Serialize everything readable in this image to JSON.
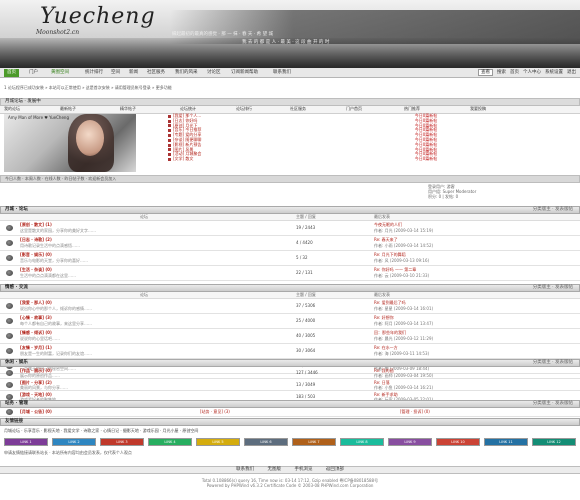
{
  "banner": {
    "logo": "Yuecheng",
    "logo_sub": "Moonshot2.cn",
    "slogan_line1": "縁起最初的最真的感觉 · 那 一 抹 · 春 天 · 希 望 城",
    "slogan_line2": "我 去 的 都 是 人 · 最 美 · 这 段 曲 开 的 时"
  },
  "nav": {
    "items": [
      {
        "label": "首页",
        "active": true
      },
      {
        "label": "门户",
        "active": false
      },
      {
        "label": "黄图空间",
        "active": false,
        "green": true
      },
      {
        "label": "统计排行",
        "active": false
      },
      {
        "label": "空间",
        "active": false
      },
      {
        "label": "新闻",
        "active": false
      },
      {
        "label": "社区服务",
        "active": false
      },
      {
        "label": "我们的风采",
        "active": false
      },
      {
        "label": "讨论区",
        "active": false
      },
      {
        "label": "订阅新闻帮助",
        "active": false
      },
      {
        "label": "联系我们",
        "active": false
      }
    ],
    "right": [
      "搜索",
      "首页",
      "个人中心",
      "系统设置",
      "退出"
    ],
    "select_value": "查看"
  },
  "search_strip": {
    "path": "1 论坛程序已成功安装 » 本站可以正常使用 » 这是首次安装 » 请用管理员帐号登录 » 更多功能"
  },
  "board_title": {
    "title": "月城论坛 · 发展中",
    "menu": [
      "我的论坛",
      "最新帖子",
      "精华帖子",
      "论坛统计",
      "论坛排行",
      "社区服务",
      "门户首页",
      "热门推荐",
      "我要投稿"
    ]
  },
  "photo": {
    "caption": "Amy Man of More ♥ YueCheng"
  },
  "mid_list": [
    "[我爱] 那个人...",
    "[日志] 你好吗",
    "[原创] 月光下",
    "[音乐] 今日推荐",
    "[专题] 爱的分享",
    "[杂谈] 随便聊聊",
    "[影视] 新片预告",
    "[图片] 风景",
    "[活动] 月城聚会",
    "[文学] 散文"
  ],
  "right_list": [
    "今日0篇新帖",
    "今日0篇新帖",
    "今日0篇新帖",
    "今日0篇新帖",
    "今日0篇新帖",
    "今日0篇新帖",
    "今日0篇新帖",
    "今日0篇新帖",
    "今日0篇新帖",
    "今日0篇新帖"
  ],
  "stats_bar": "今日人数 · 本周人数 · 在线人数 · 昨日帖子数 · 欢迎新会员加入",
  "profile": {
    "line1": "登录用户: 游客",
    "line2": "用户组: Super Moderator",
    "line3": "积分: 0  |  发帖: 0"
  },
  "sections": [
    {
      "title": "月城 · 论坛",
      "right": "分类版主 · 发表版帖",
      "cols": [
        "论坛",
        "主题 / 回复",
        "最后发表"
      ],
      "rows": [
        {
          "name": "[原创 · 散文] (1)",
          "desc": "这里是散文的家园，分享你的美好文字……",
          "count": "19 / 2443",
          "lp1": "今夜无眠的人们",
          "lp2": "作者: 月光 (2009-03-14 15:19)"
        },
        {
          "name": "[日志 · 诗歌] (2)",
          "desc": "用诗歌记录生活中的点滴感悟……",
          "count": "4 / 4420",
          "lp1": "Re: 春天来了",
          "lp2": "作者: 小雨 (2009-03-14 14:52)"
        },
        {
          "name": "[影音 · 娱乐] (0)",
          "desc": "音乐与电影的天堂，分享你的喜好……",
          "count": "5 / 32",
          "lp1": "Re: 月光下的舞蹈",
          "lp2": "作者: 风 (2009-03-13 09:16)"
        },
        {
          "name": "[生活 · 杂谈] (0)",
          "desc": "生活中的点点滴滴都在这里……",
          "count": "22 / 131",
          "lp1": "Re: 你好吗 —— 第二章",
          "lp2": "作者: 云 (2009-03-10 21:33)"
        }
      ]
    },
    {
      "title": "情感 · 交流",
      "right": "分类版主 · 发表版帖",
      "cols": [
        "论坛",
        "主题 / 回复",
        "最后发表"
      ],
      "rows": [
        {
          "name": "[我爱 · 那人] (0)",
          "desc": "说出你心中的那个人，倾诉你的感情……",
          "count": "37 / 5306",
          "lp1": "Re: 爱到最后了吗",
          "lp2": "作者: 星星 (2009-03-14 16:01)"
        },
        {
          "name": "[心情 · 故事] (3)",
          "desc": "每个人都有自己的故事，来这里分享……",
          "count": "25 / 4000",
          "lp1": "Re: 好想你",
          "lp2": "作者: 阿月 (2009-03-14 13:47)"
        },
        {
          "name": "[情感 · 倾诉] (0)",
          "desc": "说说你的心里话吧……",
          "count": "40 / 3005",
          "lp1": "回：那些年的我们",
          "lp2": "作者: 晨光 (2009-03-12 11:29)"
        },
        {
          "name": "[友情 · 岁月] (1)",
          "desc": "朋友是一生的财富，记录你们的友谊……",
          "count": "30 / 3064",
          "lp1": "Re: 在水一方",
          "lp2": "作者: 海 (2009-03-11 14:53)"
        },
        {
          "name": "[秘密 · 花园] (0)",
          "desc": "一个属于你自己的秘密空间……",
          "count": "26 / 35",
          "lp1": "Re: 花开的声音",
          "lp2": "作者: 雪 (2009-03-09 18:44)"
        }
      ]
    },
    {
      "title": "休闲 · 娱乐",
      "right": "分类版主 · 发表版帖",
      "cols": [
        "论坛",
        "主题 / 回复",
        "最后发表"
      ],
      "rows": [
        {
          "name": "[作品 · 展示] (0)",
          "desc": "展示你的原创作品……",
          "count": "127 / 3446",
          "lp1": "Re: 我的画",
          "lp2": "作者: 画师 (2009-03-04 19:50)"
        },
        {
          "name": "[图片 · 分享] (2)",
          "desc": "美丽的风景，与你分享……",
          "count": "13 / 3049",
          "lp1": "Re: 日落",
          "lp2": "作者: 小鱼 (2009-03-14 16:21)"
        },
        {
          "name": "[游戏 · 天地] (0)",
          "desc": "游戏爱好者的聚集地……",
          "count": "183 / 503",
          "lp1": "Re: 新手求助",
          "lp2": "作者: 玩家 (2009-03-05 22:01)"
        }
      ]
    },
    {
      "title": "站务 · 管理",
      "right": "分类版主 · 发表版帖",
      "cols": [
        "",
        "",
        ""
      ],
      "rows": [
        {
          "name": "[月城 · 公告] (0)",
          "desc": "",
          "count": "",
          "lp1": "[站务 · 意见] (3)",
          "lp2": "[管理 · 投诉] (0)"
        }
      ]
    }
  ],
  "links": {
    "title": "友情链接",
    "text": "月城论坛 · 乐享音乐 · 影视天地 · 我爱文学 · 诗歌之家 · 心情日记 · 摄影天地 · 游戏乐园 · 月光小屋 · 原创空间",
    "badges": [
      "LINK 1",
      "LINK 2",
      "LINK 3",
      "LINK 4",
      "LINK 5",
      "LINK 6",
      "LINK 7",
      "LINK 8",
      "LINK 9",
      "LINK 10",
      "LINK 11",
      "LINK 12"
    ],
    "badge_colors": [
      "#7d3c98",
      "#2e86c1",
      "#c0392b",
      "#27ae60",
      "#d4ac0d",
      "#5d6d7e",
      "#af601a",
      "#1abc9c",
      "#884ea0",
      "#cb4335",
      "#2471a3",
      "#138d75"
    ],
    "text2": "申请友情链接请联系站长 · 本站所有内容均由会员发表，仅代表个人观点"
  },
  "footer": {
    "links": [
      "联系我们",
      "无图版",
      "手机浏览",
      "返回顶部"
    ],
    "line1": "Total 0.108866(s) query 16, Time now is: 03-14 17:12, Gzip enabled 粤ICP备08018588号",
    "line2": "Powered by PHPWind v6.3.2 Certificate Code © 2003-08 PHPWind.com Corporation"
  }
}
